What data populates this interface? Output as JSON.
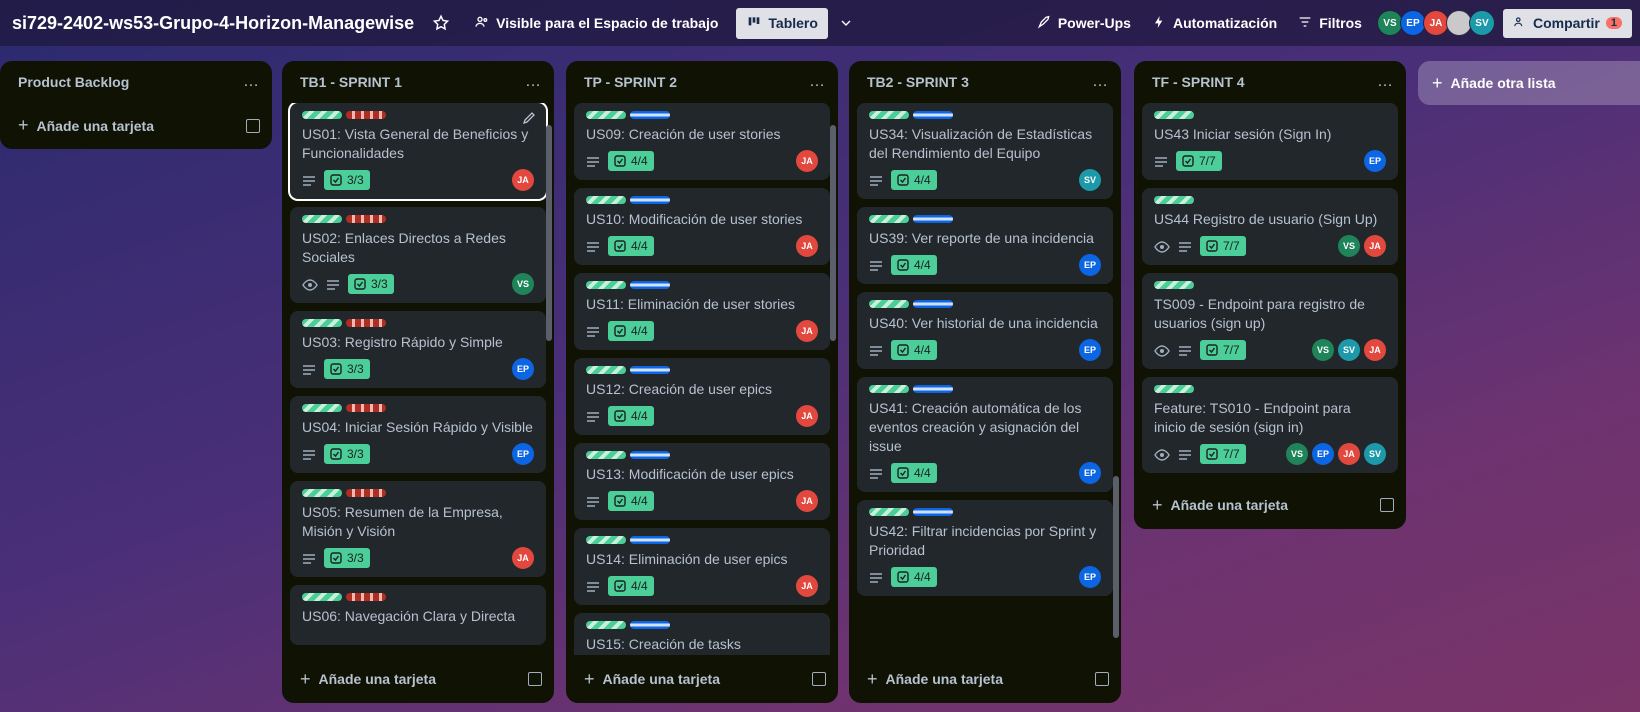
{
  "header": {
    "board_title": "si729-2402-ws53-Grupo-4-Horizon-Managewise",
    "visibility_label": "Visible para el Espacio de trabajo",
    "view_label": "Tablero",
    "powerups_label": "Power-Ups",
    "automation_label": "Automatización",
    "filters_label": "Filtros",
    "share_label": "Compartir",
    "share_count": "1",
    "avatars": [
      {
        "initials": "VS",
        "color": "#1f845a"
      },
      {
        "initials": "EP",
        "color": "#0c66e4"
      },
      {
        "initials": "JA",
        "color": "#e2483d"
      },
      {
        "initials": "",
        "color": "#c9c9c9"
      },
      {
        "initials": "SV",
        "color": "#1d9aaa"
      }
    ]
  },
  "colors": {
    "JA": "#e2483d",
    "EP": "#0c66e4",
    "VS": "#1f845a",
    "SV": "#1d9aaa"
  },
  "lists": [
    {
      "title": "Product Backlog",
      "add_card_label": "Añade una tarjeta",
      "cards": []
    },
    {
      "title": "TB1 - SPRINT 1",
      "add_card_label": "Añade una tarjeta",
      "cards": [
        {
          "labels": [
            "green",
            "red"
          ],
          "title": "US01: Vista General de Beneficios y Funcionalidades",
          "watch": false,
          "checklist": "3/3",
          "members": [
            "JA"
          ],
          "selected": true
        },
        {
          "labels": [
            "green",
            "red"
          ],
          "title": "US02: Enlaces Directos a Redes Sociales",
          "watch": true,
          "checklist": "3/3",
          "members": [
            "VS"
          ]
        },
        {
          "labels": [
            "green",
            "red"
          ],
          "title": "US03: Registro Rápido y Simple",
          "watch": false,
          "checklist": "3/3",
          "members": [
            "EP"
          ]
        },
        {
          "labels": [
            "green",
            "red"
          ],
          "title": "US04: Iniciar Sesión Rápido y Visible",
          "watch": false,
          "checklist": "3/3",
          "members": [
            "EP"
          ]
        },
        {
          "labels": [
            "green",
            "red"
          ],
          "title": "US05: Resumen de la Empresa, Misión y Visión",
          "watch": false,
          "checklist": "3/3",
          "members": [
            "JA"
          ]
        },
        {
          "labels": [
            "green",
            "red"
          ],
          "title": "US06: Navegación Clara y Directa",
          "watch": false,
          "checklist": "",
          "members": []
        }
      ]
    },
    {
      "title": "TP - SPRINT 2",
      "add_card_label": "Añade una tarjeta",
      "cards": [
        {
          "labels": [
            "green",
            "blue"
          ],
          "title": "US09: Creación de user stories",
          "watch": false,
          "checklist": "4/4",
          "members": [
            "JA"
          ]
        },
        {
          "labels": [
            "green",
            "blue"
          ],
          "title": "US10: Modificación de user stories",
          "watch": false,
          "checklist": "4/4",
          "members": [
            "JA"
          ]
        },
        {
          "labels": [
            "green",
            "blue"
          ],
          "title": "US11: Eliminación de user stories",
          "watch": false,
          "checklist": "4/4",
          "members": [
            "JA"
          ]
        },
        {
          "labels": [
            "green",
            "blue"
          ],
          "title": "US12: Creación de user epics",
          "watch": false,
          "checklist": "4/4",
          "members": [
            "JA"
          ]
        },
        {
          "labels": [
            "green",
            "blue"
          ],
          "title": "US13: Modificación de user epics",
          "watch": false,
          "checklist": "4/4",
          "members": [
            "JA"
          ]
        },
        {
          "labels": [
            "green",
            "blue"
          ],
          "title": "US14: Eliminación de user epics",
          "watch": false,
          "checklist": "4/4",
          "members": [
            "JA"
          ]
        },
        {
          "labels": [
            "green",
            "blue"
          ],
          "title": "US15: Creación de tasks",
          "watch": false,
          "checklist": "",
          "members": []
        }
      ]
    },
    {
      "title": "TB2 - SPRINT 3",
      "add_card_label": "Añade una tarjeta",
      "cards": [
        {
          "labels": [
            "green",
            "blue"
          ],
          "title": "US34: Visualización de Estadísticas del Rendimiento del Equipo",
          "watch": false,
          "checklist": "4/4",
          "members": [
            "SV"
          ]
        },
        {
          "labels": [
            "green",
            "blue"
          ],
          "title": "US39: Ver reporte de una incidencia",
          "watch": false,
          "checklist": "4/4",
          "members": [
            "EP"
          ]
        },
        {
          "labels": [
            "green",
            "blue"
          ],
          "title": "US40: Ver historial de una incidencia",
          "watch": false,
          "checklist": "4/4",
          "members": [
            "EP"
          ]
        },
        {
          "labels": [
            "green",
            "blue"
          ],
          "title": "US41: Creación automática de los eventos creación y asignación del issue",
          "watch": false,
          "checklist": "4/4",
          "members": [
            "EP"
          ]
        },
        {
          "labels": [
            "green",
            "blue"
          ],
          "title": "US42: Filtrar incidencias por Sprint y Prioridad",
          "watch": false,
          "checklist": "4/4",
          "members": [
            "EP"
          ]
        }
      ]
    },
    {
      "title": "TF - SPRINT 4",
      "add_card_label": "Añade una tarjeta",
      "cards": [
        {
          "labels": [
            "green"
          ],
          "title": "US43 Iniciar sesión (Sign In)",
          "watch": false,
          "checklist": "7/7",
          "members": [
            "EP"
          ]
        },
        {
          "labels": [
            "green"
          ],
          "title": "US44 Registro de usuario (Sign Up)",
          "watch": true,
          "checklist": "7/7",
          "members": [
            "VS",
            "JA"
          ]
        },
        {
          "labels": [
            "green"
          ],
          "title": "TS009 - Endpoint para registro de usuarios (sign up)",
          "watch": true,
          "checklist": "7/7",
          "members": [
            "VS",
            "SV",
            "JA"
          ]
        },
        {
          "labels": [
            "green"
          ],
          "title": "Feature: TS010 - Endpoint para inicio de sesión (sign in)",
          "watch": true,
          "checklist": "7/7",
          "members": [
            "VS",
            "EP",
            "JA",
            "SV"
          ]
        }
      ]
    }
  ],
  "add_list_label": "Añade otra lista"
}
